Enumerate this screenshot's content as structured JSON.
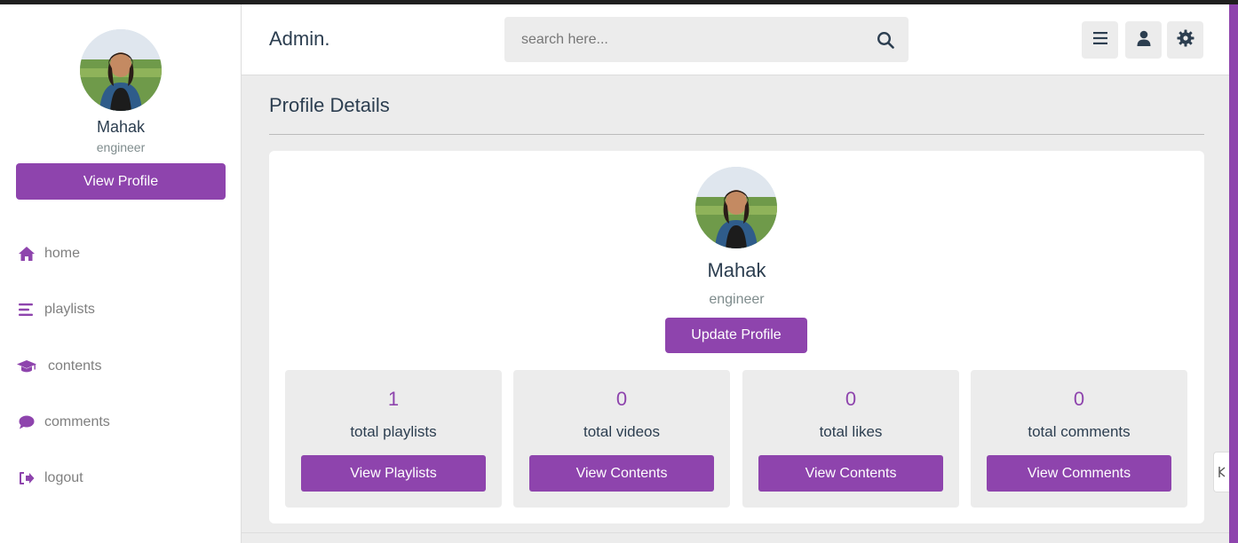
{
  "user": {
    "name": "Mahak",
    "role": "engineer"
  },
  "sidebar": {
    "view_profile_label": "View Profile",
    "items": [
      {
        "label": "home",
        "icon": "home-icon"
      },
      {
        "label": "playlists",
        "icon": "bars-icon"
      },
      {
        "label": "contents",
        "icon": "graduation-cap-icon"
      },
      {
        "label": "comments",
        "icon": "comment-icon"
      },
      {
        "label": "logout",
        "icon": "logout-icon"
      }
    ]
  },
  "header": {
    "logo": "Admin.",
    "search_placeholder": "search here...",
    "buttons": [
      "menu-icon",
      "user-icon",
      "settings-icon"
    ]
  },
  "main": {
    "page_title": "Profile Details",
    "update_label": "Update Profile",
    "stats": [
      {
        "value": "1",
        "label": "total playlists",
        "button": "View Playlists"
      },
      {
        "value": "0",
        "label": "total videos",
        "button": "View Contents"
      },
      {
        "value": "0",
        "label": "total likes",
        "button": "View Contents"
      },
      {
        "value": "0",
        "label": "total comments",
        "button": "View Comments"
      }
    ]
  },
  "colors": {
    "accent": "#8e44ad",
    "text": "#2c3e50",
    "muted": "#7f8c8d",
    "panel": "#ececec"
  }
}
